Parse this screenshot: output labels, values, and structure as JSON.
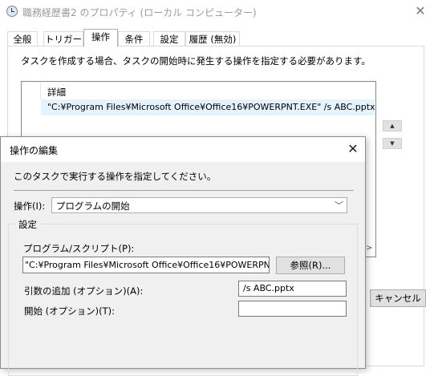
{
  "background_window": {
    "title": "職務経歴書2 のプロパティ (ローカル コンピューター)",
    "title_icon": "clock-icon",
    "close_icon": "close-icon",
    "tabs": [
      {
        "label": "全般"
      },
      {
        "label": "トリガー"
      },
      {
        "label": "操作",
        "active": true
      },
      {
        "label": "条件"
      },
      {
        "label": "設定"
      },
      {
        "label": "履歴 (無効)"
      }
    ],
    "description": "タスクを作成する場合、タスクの開始時に発生する操作を指定する必要があります。",
    "list": {
      "header": "詳細",
      "rows": [
        "\"C:¥Program Files¥Microsoft Office¥Office16¥POWERPNT.EXE\" /s ABC.pptx"
      ]
    },
    "move_up_icon": "triangle-up-icon",
    "move_down_icon": "triangle-down-icon",
    "scroll_right_icon": "chevron-right-icon",
    "cancel_label": "キャンセル"
  },
  "edit_dialog": {
    "title": "操作の編集",
    "close_icon": "close-icon",
    "description": "このタスクで実行する操作を指定してください。",
    "action_label": "操作(I):",
    "action_value": "プログラムの開始",
    "action_chevron_icon": "chevron-down-icon",
    "settings_label": "設定",
    "program_label": "プログラム/スクリプト(P):",
    "program_value": "\"C:¥Program Files¥Microsoft Office¥Office16¥POWERPNT.",
    "browse_label": "参照(R)...",
    "args_label": "引数の追加 (オプション)(A):",
    "args_value": "/s ABC.pptx",
    "start_label": "開始 (オプション)(T):",
    "start_value": ""
  }
}
